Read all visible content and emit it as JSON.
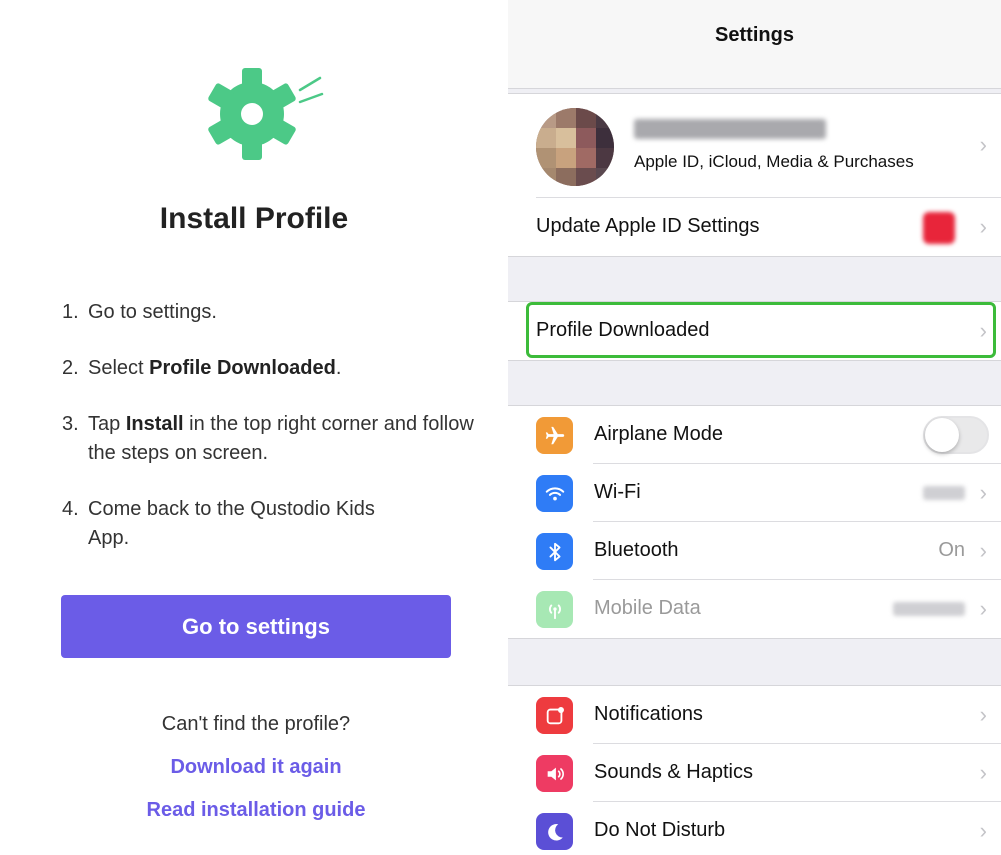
{
  "left": {
    "gear_icon": "gear-icon",
    "title": "Install Profile",
    "steps": [
      {
        "num": "1.",
        "pre": "Go to settings.",
        "bold": "",
        "post": ""
      },
      {
        "num": "2.",
        "pre": "Select ",
        "bold": "Profile Downloaded",
        "post": "."
      },
      {
        "num": "3.",
        "pre": "Tap ",
        "bold": "Install",
        "post": " in the top right corner and follow the steps on screen."
      },
      {
        "num": "4.",
        "pre": "Come back to the Qustodio Kids App.",
        "bold": "",
        "post": ""
      }
    ],
    "button": "Go to settings",
    "cant_find": "Can't find the profile?",
    "link_download": "Download it again",
    "link_guide": "Read installation guide",
    "accent": "#6b5ce7",
    "gear_color": "#4cc987"
  },
  "right": {
    "nav_title": "Settings",
    "apple_id_sub": "Apple ID, iCloud, Media & Purchases",
    "update_label": "Update Apple ID Settings",
    "profile_downloaded": "Profile Downloaded",
    "highlight_color": "#3cbb3a",
    "rows1": [
      {
        "label": "Airplane Mode",
        "icon": "airplane-icon",
        "color": "#f19a37",
        "accessory": "toggle-off"
      },
      {
        "label": "Wi-Fi",
        "icon": "wifi-icon",
        "color": "#2f7cf6",
        "accessory": "blurred-value"
      },
      {
        "label": "Bluetooth",
        "icon": "bluetooth-icon",
        "color": "#2f7cf6",
        "value": "On"
      },
      {
        "label": "Mobile Data",
        "icon": "antenna-icon",
        "color": "#a7e8b4",
        "accessory": "blurred-value"
      }
    ],
    "rows2": [
      {
        "label": "Notifications",
        "icon": "notifications-icon",
        "color": "#ee3b3f"
      },
      {
        "label": "Sounds & Haptics",
        "icon": "speaker-icon",
        "color": "#ee3b63"
      },
      {
        "label": "Do Not Disturb",
        "icon": "moon-icon",
        "color": "#5b4fd6"
      }
    ]
  }
}
